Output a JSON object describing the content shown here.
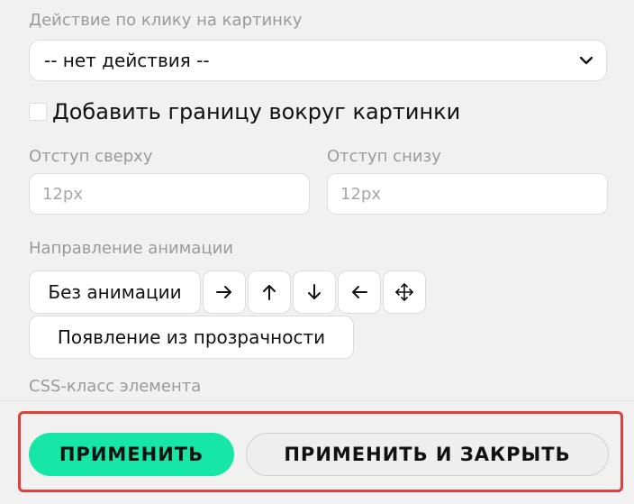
{
  "fields": {
    "click_action": {
      "label": "Действие по клику на картинку",
      "value": "-- нет действия --"
    },
    "border_checkbox": {
      "label": "Добавить границу вокруг картинки",
      "checked": false
    },
    "padding_top": {
      "label": "Отступ сверху",
      "placeholder": "12px"
    },
    "padding_bottom": {
      "label": "Отступ снизу",
      "placeholder": "12px"
    },
    "animation": {
      "label": "Направление анимации",
      "options": [
        {
          "label": "Без анимации"
        },
        {
          "icon": "arrow-right-icon"
        },
        {
          "icon": "arrow-up-icon"
        },
        {
          "icon": "arrow-down-icon"
        },
        {
          "icon": "arrow-left-icon"
        },
        {
          "icon": "move-all-directions-icon"
        },
        {
          "label": "Появление из прозрачности"
        }
      ]
    },
    "css_class": {
      "label": "CSS-класс элемента"
    }
  },
  "footer": {
    "apply_label": "ПРИМЕНИТЬ",
    "apply_close_label": "ПРИМЕНИТЬ И ЗАКРЫТЬ"
  },
  "colors": {
    "primary": "#16e7a6",
    "highlight_border": "#e0403c",
    "background": "#f1f1f1"
  }
}
